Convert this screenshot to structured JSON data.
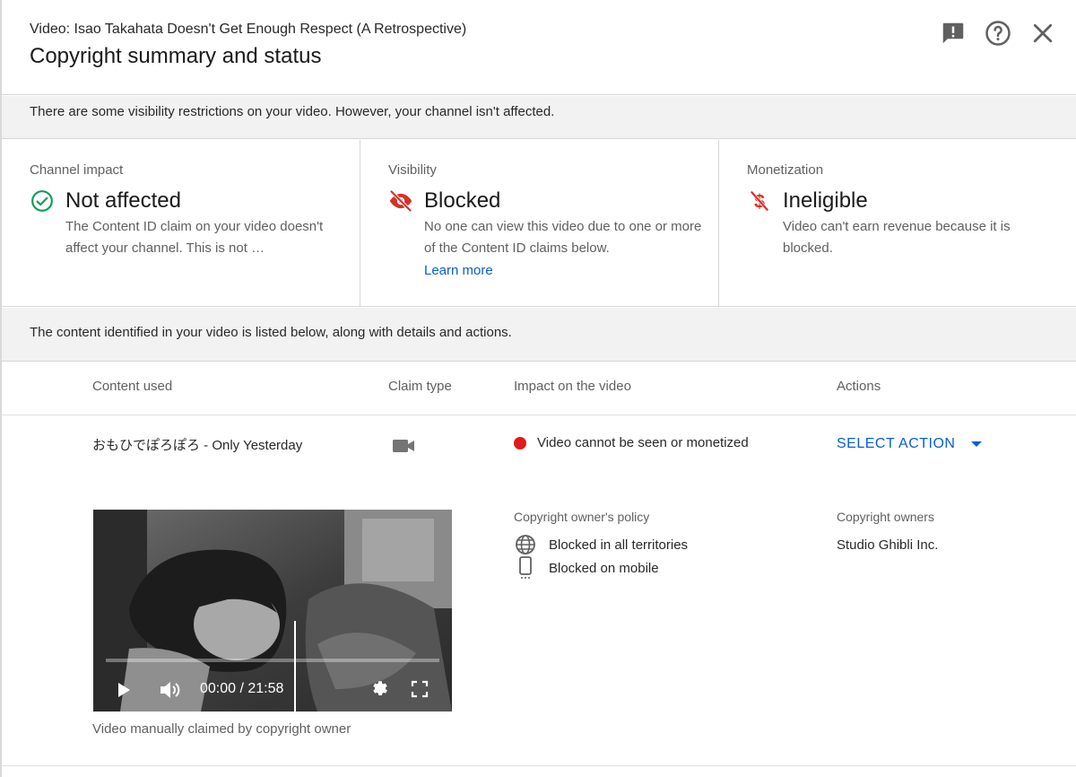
{
  "header": {
    "video_title": "Video: Isao Takahata Doesn't Get Enough Respect (A Retrospective)",
    "dialog_title": "Copyright summary and status",
    "icons": [
      "feedback-icon",
      "help-icon",
      "close-icon"
    ]
  },
  "notice": "There are some visibility restrictions on your video. However, your channel isn't affected.",
  "cards": [
    {
      "label": "Channel impact",
      "status": "Not affected",
      "status_icon": "check-circle-icon",
      "status_color": "#0f9d58",
      "description": "The Content ID claim on your video doesn't affect your channel. This is not …"
    },
    {
      "label": "Visibility",
      "status": "Blocked",
      "status_icon": "eye-off-icon",
      "status_color": "#d93025",
      "description": "No one can view this video due to one or more of the Content ID claims below.",
      "link": "Learn more"
    },
    {
      "label": "Monetization",
      "status": "Ineligible",
      "status_icon": "dollar-off-icon",
      "status_color": "#d93025",
      "description": "Video can't earn revenue because it is blocked."
    }
  ],
  "content_bar": "The content identified in your video is listed below, along with details and actions.",
  "table": {
    "headers": [
      "Content used",
      "Claim type",
      "Impact on the video",
      "Actions"
    ],
    "row": {
      "content": "おもひでぽろぽろ - Only Yesterday",
      "claim_type_icon": "video-camera-icon",
      "impact": "Video cannot be seen or monetized",
      "impact_color": "#e01b1b",
      "action": "SELECT ACTION"
    }
  },
  "preview": {
    "timecode": "00:00 / 21:58",
    "caption": "Video manually claimed by copyright owner"
  },
  "policy": {
    "label": "Copyright owner's policy",
    "items": [
      {
        "icon": "globe-icon",
        "text": "Blocked in all territories"
      },
      {
        "icon": "mobile-icon",
        "text": "Blocked on mobile"
      }
    ]
  },
  "owners": {
    "label": "Copyright owners",
    "name": "Studio Ghibli Inc."
  }
}
